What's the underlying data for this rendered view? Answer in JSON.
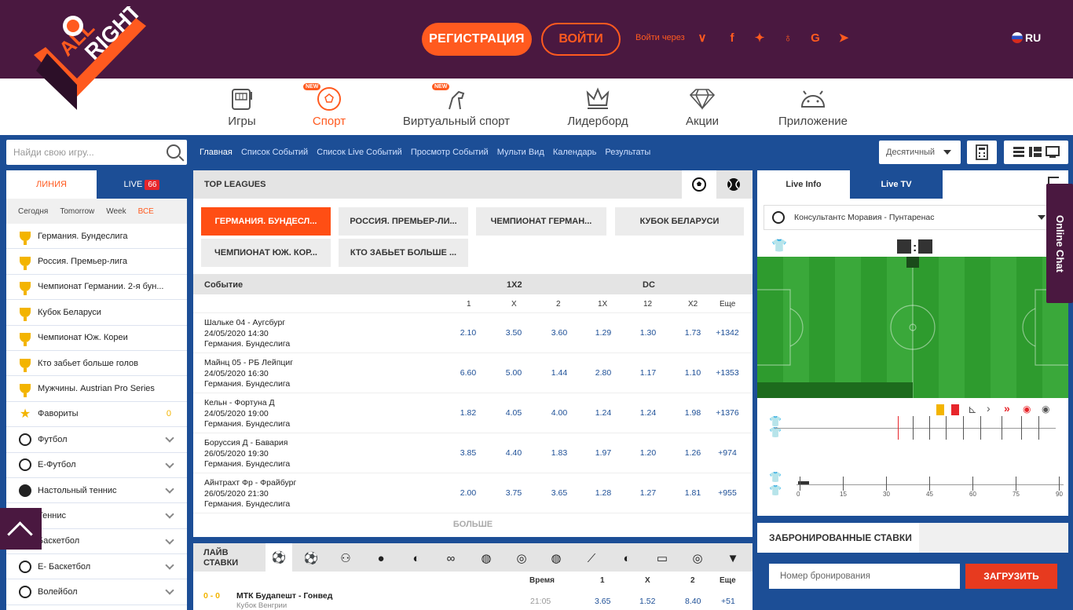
{
  "header": {
    "logo_text": "ALLRIGHT",
    "register": "РЕГИСТРАЦИЯ",
    "login": "ВОЙТИ",
    "login_via": "Войти через",
    "lang": "RU",
    "socials": [
      "vk-icon",
      "facebook-icon",
      "twitter-icon",
      "odnoklassniki-icon",
      "google-icon",
      "telegram-icon"
    ]
  },
  "nav": [
    {
      "label": "Игры",
      "icon": "slot-machine-icon"
    },
    {
      "label": "Спорт",
      "icon": "soccer-ball-icon",
      "badge": "NEW"
    },
    {
      "label": "Виртуальный спорт",
      "icon": "horse-icon",
      "badge": "NEW"
    },
    {
      "label": "Лидерборд",
      "icon": "crown-icon"
    },
    {
      "label": "Акции",
      "icon": "diamond-icon"
    },
    {
      "label": "Приложение",
      "icon": "android-icon"
    }
  ],
  "search": {
    "placeholder": "Найди свою игру..."
  },
  "breadcrumbs": [
    "Главная",
    "Список Событий",
    "Список Live Событий",
    "Просмотр Событий",
    "Мульти Вид",
    "Календарь",
    "Результаты"
  ],
  "odds_format": "Десятичный",
  "sidebar": {
    "tab_line": "ЛИНИЯ",
    "tab_live": "LIVE",
    "live_count": "66",
    "filters": [
      "Сегодня",
      "Tomorrow",
      "Week",
      "ВСЕ"
    ],
    "leagues": [
      "Германия. Бундеслига",
      "Россия. Премьер-лига",
      "Чемпионат Германии. 2-я бун...",
      "Кубок Беларуси",
      "Чемпионат Юж. Кореи",
      "Кто забьет больше голов",
      "Мужчины. Austrian Pro Series"
    ],
    "favorites": "Фавориты",
    "favorites_count": "0",
    "sports": [
      "Футбол",
      "Е-Футбол",
      "Настольный теннис",
      "Теннис",
      "Баскетбол",
      "Е- Баскетбол",
      "Волейбол"
    ]
  },
  "top_leagues": {
    "title": "TOP LEAGUES",
    "chips": [
      "ГЕРМАНИЯ. БУНДЕСЛ...",
      "РОССИЯ. ПРЕМЬЕР-ЛИ...",
      "ЧЕМПИОНАТ ГЕРМАН...",
      "КУБОК БЕЛАРУСИ",
      "ЧЕМПИОНАТ ЮЖ. КОР...",
      "КТО ЗАБЬЕТ БОЛЬШЕ ..."
    ],
    "col_event": "Событие",
    "group_1x2": "1X2",
    "group_dc": "DC",
    "cols": [
      "1",
      "X",
      "2",
      "1X",
      "12",
      "X2",
      "Еще"
    ],
    "events": [
      {
        "name": "Шальке 04 - Аугсбург",
        "date": "24/05/2020 14:30",
        "league": "Германия. Бундеслига",
        "odds": [
          "2.10",
          "3.50",
          "3.60",
          "1.29",
          "1.30",
          "1.73"
        ],
        "more": "+1342"
      },
      {
        "name": "Майнц 05 - РБ Лейпциг",
        "date": "24/05/2020 16:30",
        "league": "Германия. Бундеслига",
        "odds": [
          "6.60",
          "5.00",
          "1.44",
          "2.80",
          "1.17",
          "1.10"
        ],
        "more": "+1353"
      },
      {
        "name": "Кельн - Фортуна Д",
        "date": "24/05/2020 19:00",
        "league": "Германия. Бундеслига",
        "odds": [
          "1.82",
          "4.05",
          "4.00",
          "1.24",
          "1.24",
          "1.98"
        ],
        "more": "+1376"
      },
      {
        "name": "Боруссия Д - Бавария",
        "date": "26/05/2020 19:30",
        "league": "Германия. Бундеслига",
        "odds": [
          "3.85",
          "4.40",
          "1.83",
          "1.97",
          "1.20",
          "1.26"
        ],
        "more": "+974"
      },
      {
        "name": "Айнтрахт Фр - Фрайбург",
        "date": "26/05/2020 21:30",
        "league": "Германия. Бундеслига",
        "odds": [
          "2.00",
          "3.75",
          "3.65",
          "1.28",
          "1.27",
          "1.81"
        ],
        "more": "+955"
      }
    ],
    "more_label": "БОЛЬШЕ"
  },
  "live_bets": {
    "title": "ЛАЙВ СТАВКИ",
    "cols": [
      "Время",
      "1",
      "X",
      "2",
      "Еще"
    ],
    "row": {
      "score": "0 - 0",
      "name": "МТК Будапешт - Гонвед",
      "league": "Кубок Венгрии",
      "time": "21:05",
      "odds": [
        "3.65",
        "1.52",
        "8.40"
      ],
      "more": "+51"
    }
  },
  "right": {
    "tab_info": "Live Info",
    "tab_tv": "Live TV",
    "match": "Консультантс Моравия - Пунтаренас",
    "score_sep": ":",
    "timeline": [
      "0",
      "15",
      "30",
      "45",
      "60",
      "75",
      "90"
    ]
  },
  "chat": "Online Chat",
  "booked": {
    "title": "ЗАБРОНИРОВАННЫЕ СТАВКИ",
    "placeholder": "Номер бронирования",
    "button": "ЗАГРУЗИТЬ"
  }
}
